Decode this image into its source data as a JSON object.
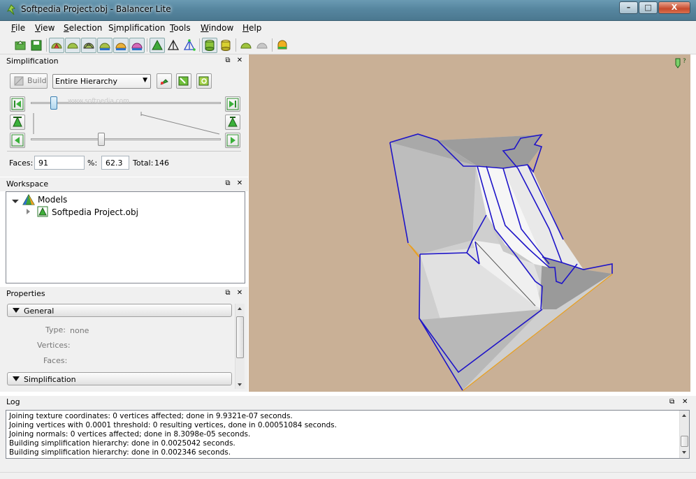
{
  "window": {
    "title": "Softpedia Project.obj - Balancer Lite",
    "minimize": "–",
    "maximize": "□",
    "close": "X"
  },
  "menu": {
    "file": {
      "pre": "",
      "u": "F",
      "post": "ile"
    },
    "view": {
      "pre": "",
      "u": "V",
      "post": "iew"
    },
    "selection": {
      "pre": "",
      "u": "S",
      "post": "election"
    },
    "simplification": {
      "pre": "S",
      "u": "i",
      "post": "mplification"
    },
    "tools": {
      "pre": "",
      "u": "T",
      "post": "ools"
    },
    "window": {
      "pre": "",
      "u": "W",
      "post": "indow"
    },
    "help": {
      "pre": "",
      "u": "H",
      "post": "elp"
    }
  },
  "simplification": {
    "title": "Simplification",
    "build_label": "Build",
    "scope_selected": "Entire Hierarchy",
    "slider1": 0.12,
    "slider2": 0.37,
    "faces_label": "Faces:",
    "faces_value": "91",
    "percent_label": "%:",
    "percent_value": "62.3",
    "total_label": "Total:",
    "total_value": "146"
  },
  "workspace": {
    "title": "Workspace",
    "root_label": "Models",
    "child_label": "Softpedia Project.obj"
  },
  "properties": {
    "title": "Properties",
    "general_label": "General",
    "type_label": "Type:",
    "type_value": "none",
    "vertices_label": "Vertices:",
    "faces_label": "Faces:",
    "simplification_label": "Simplification"
  },
  "log": {
    "title": "Log",
    "lines": [
      "Joining texture coordinates: 0 vertices affected; done in 9.9321e-07 seconds.",
      "Joining vertices with 0.0001 threshold: 0 resulting vertices, done in 0.00051084 seconds.",
      "Joining normals: 0 vertices affected; done in 8.3098e-05 seconds.",
      "Building simplification hierarchy: done in 0.0025042 seconds.",
      "Building simplification hierarchy: done in 0.002346 seconds."
    ]
  },
  "colors": {
    "viewport_bg": "#c9b096",
    "wire": "#1e14c8",
    "edge_accent": "#e8a020"
  },
  "icons": [
    "app-icon",
    "open-icon",
    "save-icon",
    "lod-icon",
    "cylinder-icon",
    "pyramid-icon",
    "hemisphere-icon",
    "help-cursor-icon",
    "float-icon",
    "close-icon"
  ]
}
